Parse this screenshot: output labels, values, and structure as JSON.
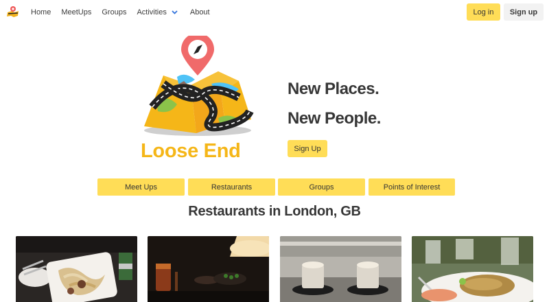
{
  "nav": {
    "logo_icon": "loose-end-logo-icon",
    "links": [
      "Home",
      "MeetUps",
      "Groups",
      "Activities",
      "About"
    ],
    "dropdown_icon": "chevron-down-icon",
    "login_label": "Log in",
    "signup_label": "Sign up"
  },
  "hero": {
    "illustration_icon": "map-pin-illustration",
    "brand_name": "Loose End",
    "tagline_line1": "New Places.",
    "tagline_line2": "New People.",
    "signup_label": "Sign Up"
  },
  "categories": [
    "Meet Ups",
    "Restaurants",
    "Groups",
    "Points of Interest"
  ],
  "section_title": "Restaurants in London, GB",
  "restaurants": [
    {
      "image": "noodle-dish-photo"
    },
    {
      "image": "dark-bar-drinks-photo"
    },
    {
      "image": "coffee-cups-photo"
    },
    {
      "image": "plated-food-photo"
    }
  ],
  "colors": {
    "accent": "#ffdd57",
    "brand": "#f5b618",
    "text": "#363636",
    "light_button": "#f2f2f2"
  }
}
